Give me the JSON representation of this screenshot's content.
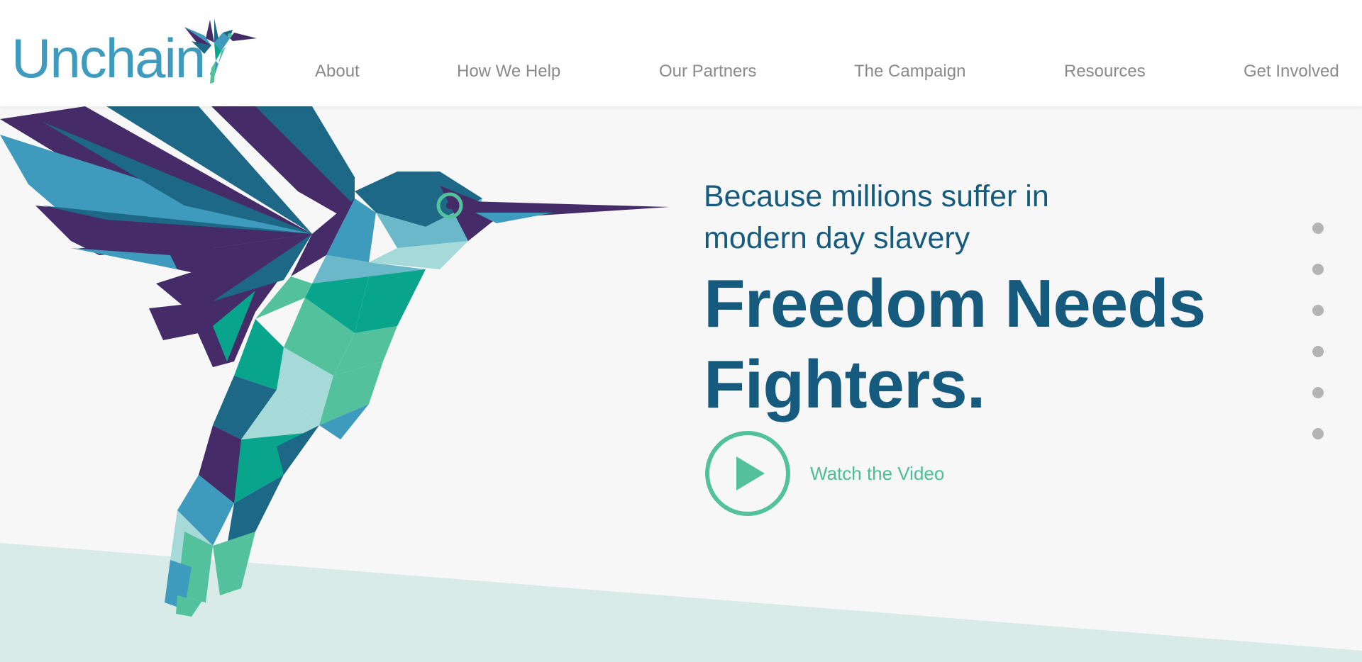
{
  "brand": {
    "name": "Unchain",
    "logo_icon": "hummingbird-icon"
  },
  "nav": {
    "items": [
      {
        "label": "About"
      },
      {
        "label": "How We Help"
      },
      {
        "label": "Our Partners"
      },
      {
        "label": "The Campaign"
      },
      {
        "label": "Resources"
      },
      {
        "label": "Get Involved"
      }
    ]
  },
  "hero": {
    "subtitle": "Because millions suffer in modern day slavery",
    "title": "Freedom Needs Fighters.",
    "cta_label": "Watch the Video",
    "cta_icon": "play-icon",
    "illustration_icon": "hummingbird-illustration"
  },
  "slider": {
    "dot_count": 6
  },
  "colors": {
    "brand_blue": "#3f9bbd",
    "heading_blue": "#165b7d",
    "accent_green": "#4dbd95",
    "purple": "#452c69",
    "teal": "#08a48c",
    "nav_gray": "#8a8a8a",
    "background": "#f7f7f7",
    "band": "#d9ebe9"
  }
}
